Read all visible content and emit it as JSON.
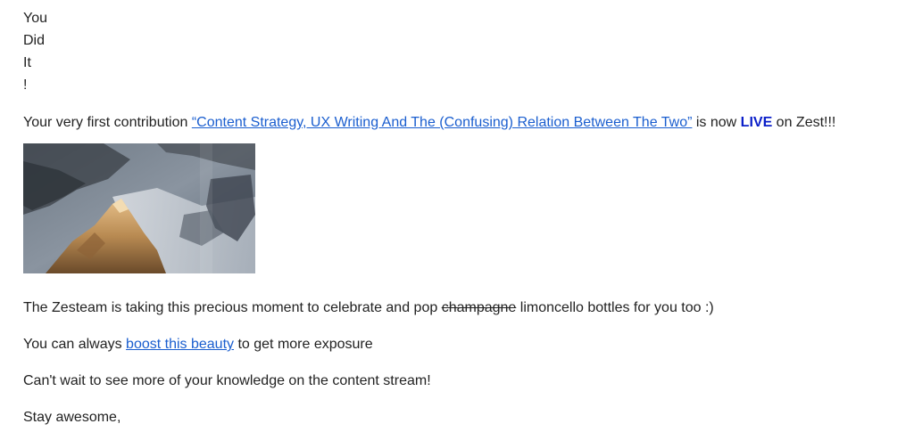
{
  "heading": {
    "words": [
      "You",
      "Did",
      "It",
      "!"
    ]
  },
  "intro": {
    "prefix": "Your very first contribution ",
    "article_link": "“Content Strategy, UX Writing And The (Confusing) Relation Between The Two”",
    "middle": " is now ",
    "live": "LIVE",
    "suffix": " on Zest!!!"
  },
  "celebrate": {
    "prefix": "The Zesteam is taking this precious moment to celebrate and pop ",
    "struck": "champagne",
    "suffix": " limoncello bottles for you too :)"
  },
  "boost": {
    "prefix": "You can always ",
    "link": "boost this beauty",
    "suffix": " to get more exposure"
  },
  "cant_wait": "Can't wait to see more of your knowledge on the content stream!",
  "signoff": "Stay awesome,",
  "colors": {
    "link": "#1a5ecf",
    "live": "#0b1fc9",
    "text": "#222222"
  }
}
